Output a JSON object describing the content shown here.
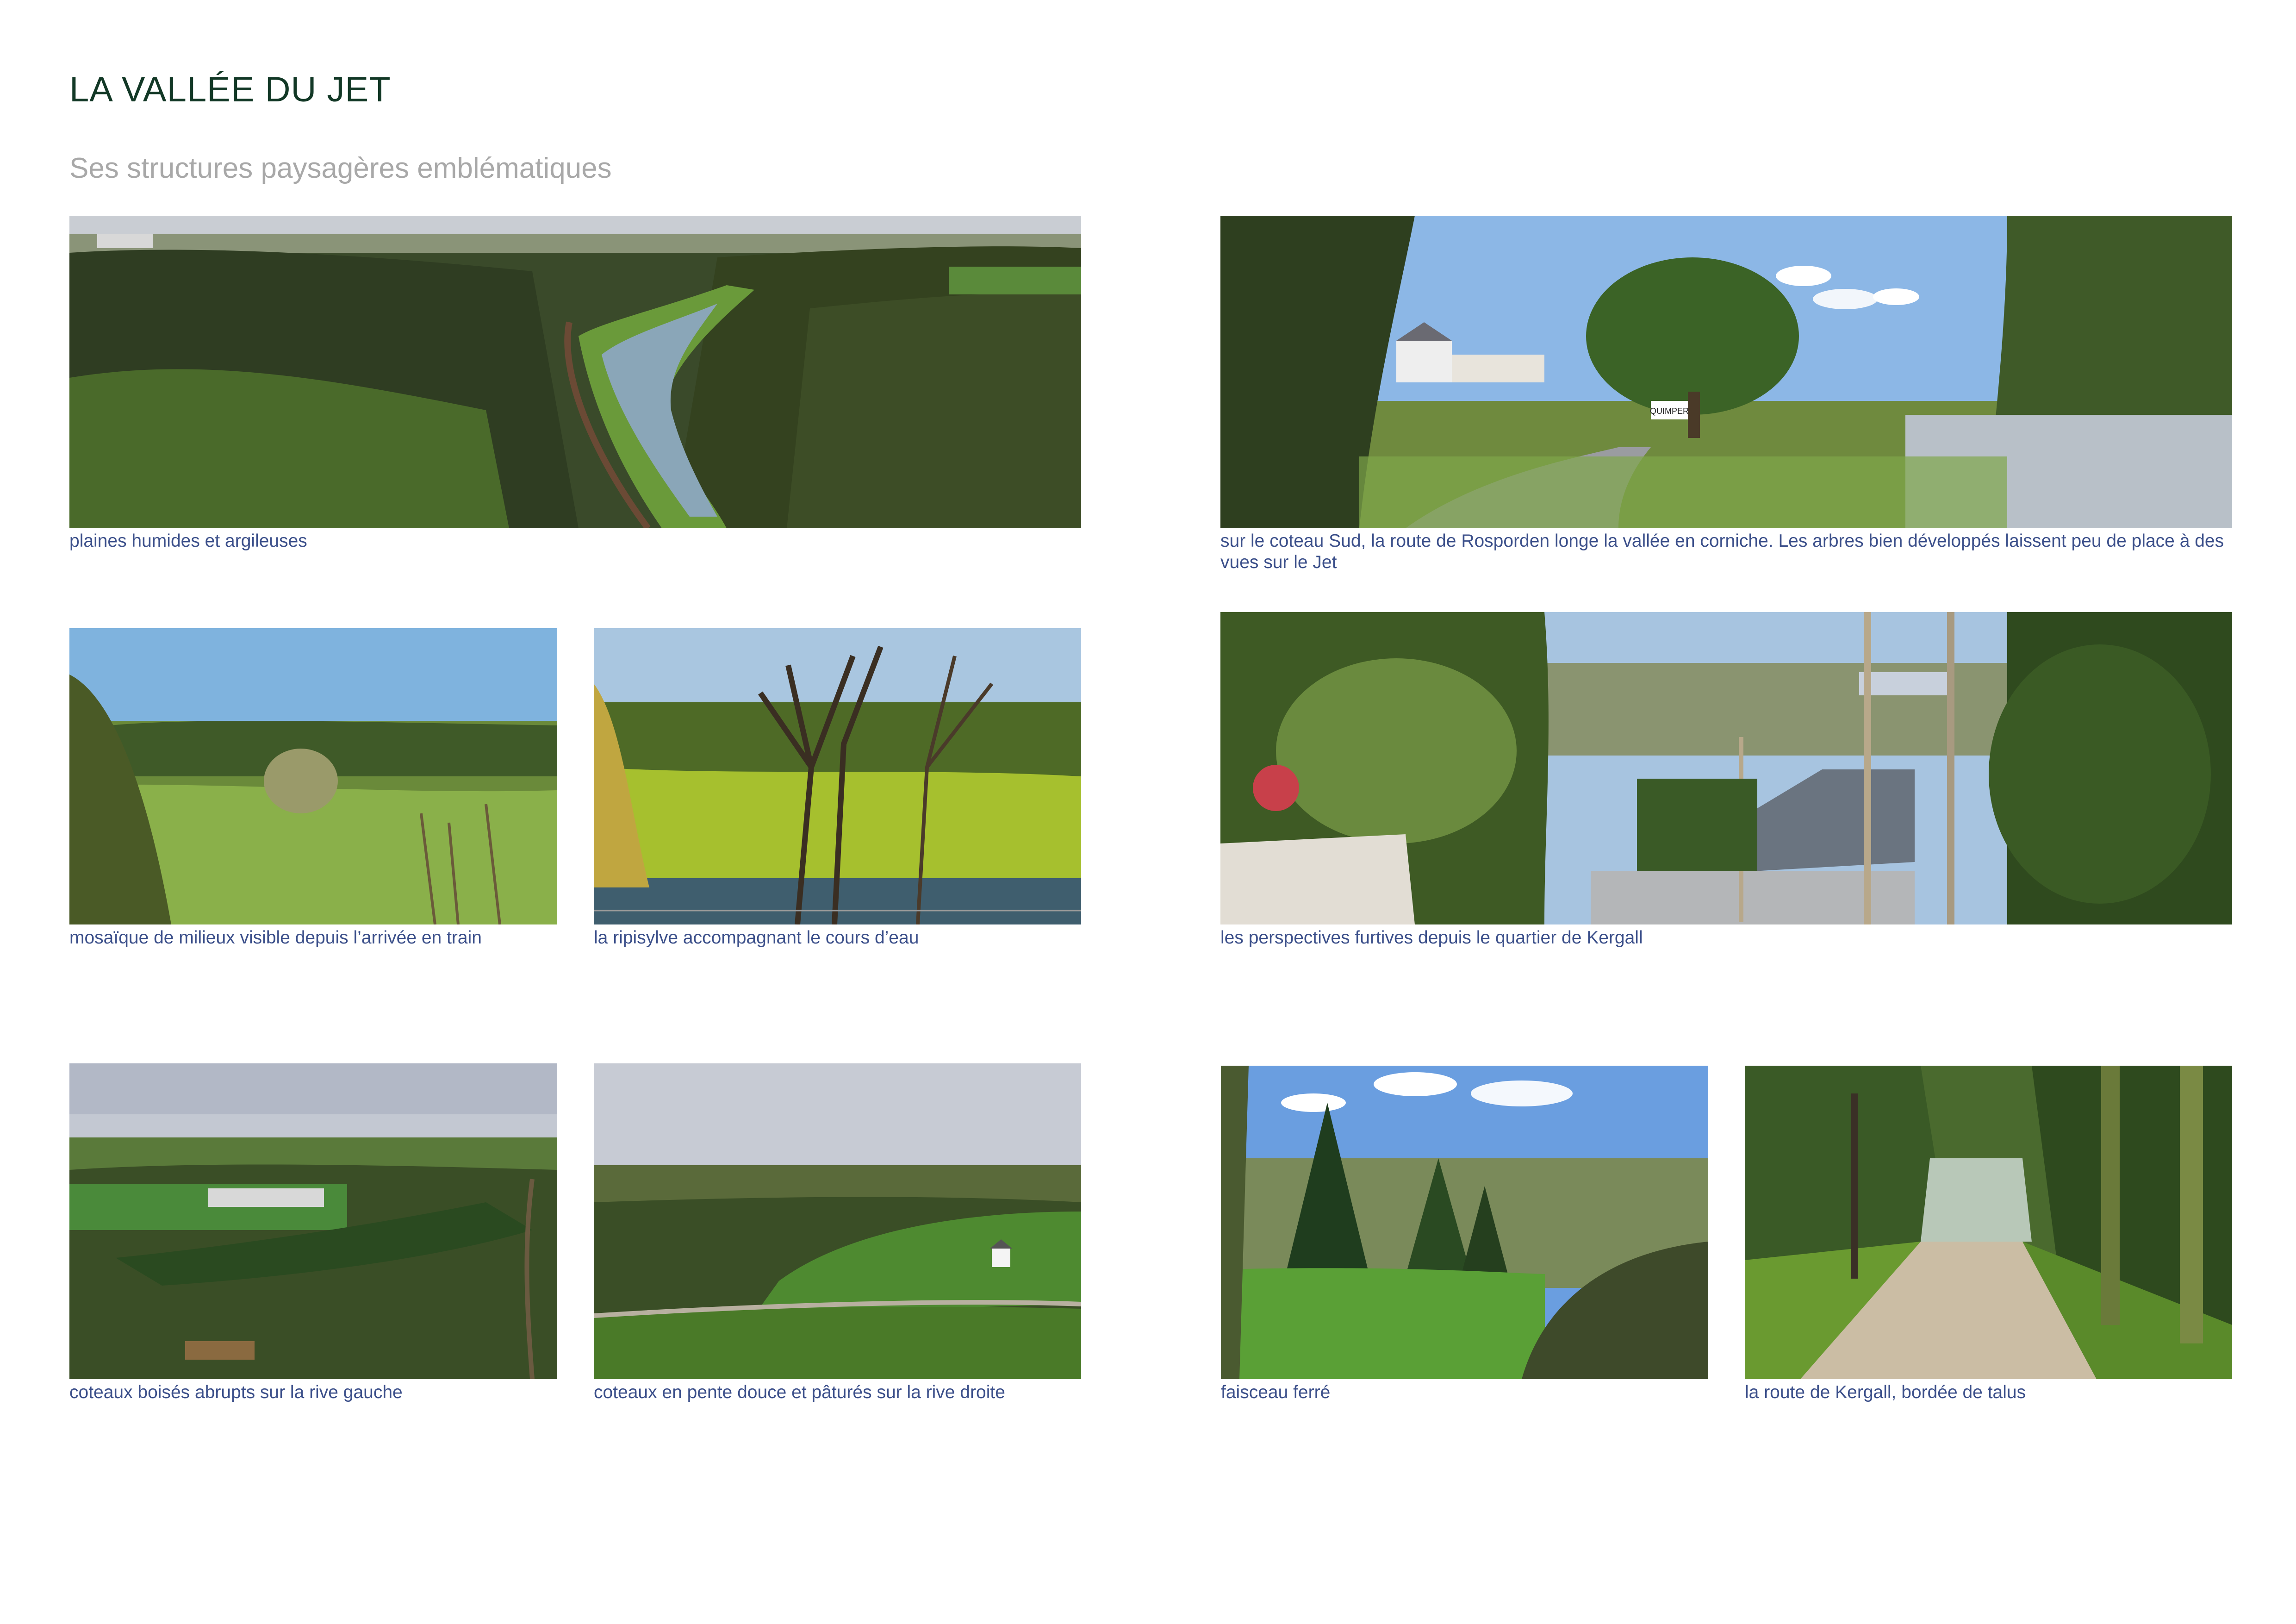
{
  "page": {
    "title": "LA VALLÉE DU JET",
    "subtitle": "Ses structures paysagères emblématiques"
  },
  "photos": [
    {
      "caption": "plaines humides et argileuses"
    },
    {
      "caption": "sur le coteau Sud, la route de Rosporden longe la vallée en corniche. Les arbres bien développés laissent peu de place à des vues sur le Jet",
      "sign_text": "QUIMPER"
    },
    {
      "caption": "mosaïque de milieux visible depuis l’arrivée en train"
    },
    {
      "caption": "la ripisylve accompagnant le cours d’eau"
    },
    {
      "caption": "les perspectives furtives depuis le quartier de Kergall"
    },
    {
      "caption": "coteaux boisés abrupts sur la rive gauche"
    },
    {
      "caption": "coteaux en pente douce et pâturés sur la rive droite"
    },
    {
      "caption": "faisceau ferré"
    },
    {
      "caption": "la route de Kergall, bordée de talus"
    }
  ],
  "colors": {
    "title": "#123826",
    "subtitle": "#a8a8a8",
    "caption": "#3b4f8a"
  }
}
